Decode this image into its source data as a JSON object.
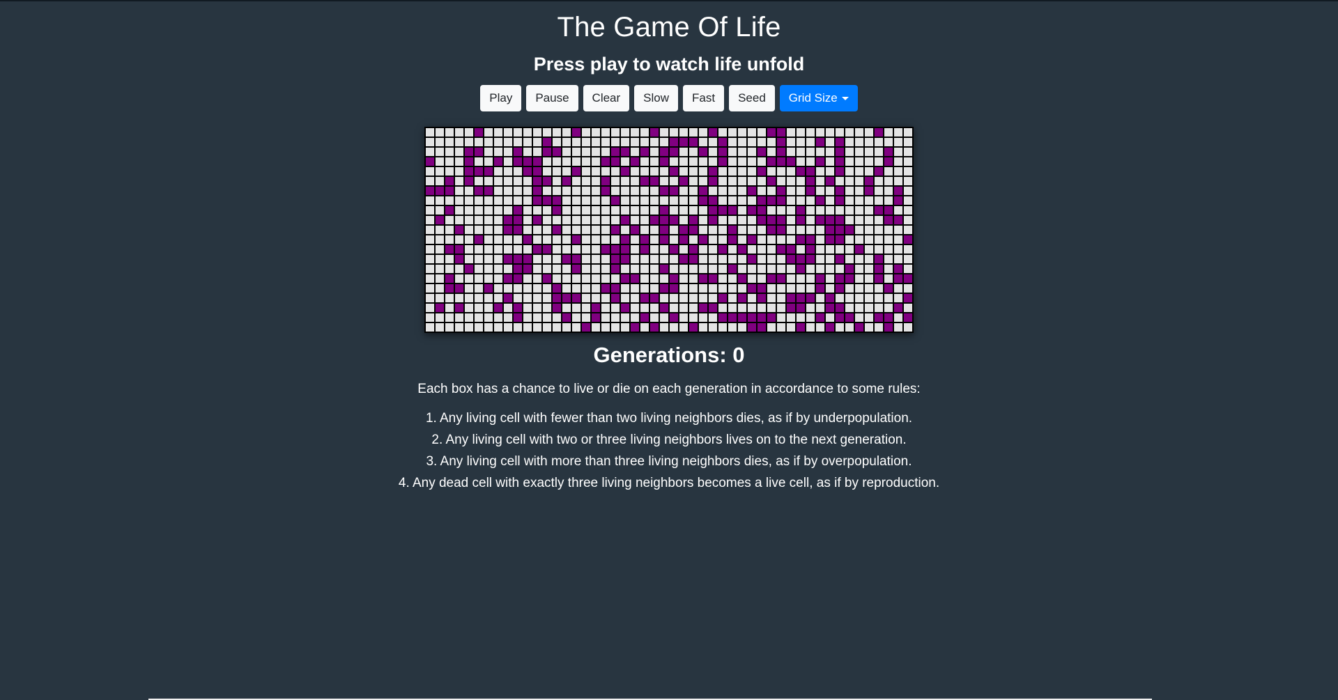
{
  "header": {
    "title": "The Game Of Life",
    "subtitle": "Press play to watch life unfold"
  },
  "toolbar": {
    "play": "Play",
    "pause": "Pause",
    "clear": "Clear",
    "slow": "Slow",
    "fast": "Fast",
    "seed": "Seed",
    "grid_size": "Grid Size"
  },
  "grid": {
    "alive_color": "#800080",
    "dead_color": "#e4e4e4",
    "rows": [
      "00000100000000010000000100000100000110000000001000000",
      "0000000000001000000000000111001000001000101000000000",
      "0000110001001100000110101100101000101000001000010000",
      "1000100101110000001101001000001000011100101000010000",
      "0000111000110001000010000100010000100011001000100000",
      "0010100000011010001000110010010000010001010001000000",
      "1110011000010000001000001100100001001001001001001000",
      "0000000000011100000100000000110000111000101000001000",
      "0010000001000100000000001000011101100010000000110000",
      "0100000011010000000010011101010000111010111000011000",
      "0001000011000100000101001011000100011000011100000000",
      "0000010000100001000010101010100101000011011000000100",
      "0011000000011000001110100101001010001101000010000000",
      "0001000011100011000110000011000001000111001000100000",
      "0000100001100001000100001000000100000010000100101000",
      "0010000011001000000011000100110010011000101100101100",
      "0011001000000100001100001100000001100000101000010000",
      "0000000010000111000100110000001010100111010000000100",
      "0101000101000100010010001000110000000110011000001000",
      "0000000001000010010000100100001111110000101100110100",
      "0000000000000000100001010001000001100010010010010010"
    ]
  },
  "status": {
    "generations_label": "Generations: 0"
  },
  "rules": {
    "intro": "Each box has a chance to live or die on each generation in accordance to some rules:",
    "items": [
      "1. Any living cell with fewer than two living neighbors dies, as if by underpopulation.",
      "2. Any living cell with two or three living neighbors lives on to the next generation.",
      "3. Any living cell with more than three living neighbors dies, as if by overpopulation.",
      "4. Any dead cell with exactly three living neighbors becomes a live cell, as if by reproduction."
    ]
  }
}
